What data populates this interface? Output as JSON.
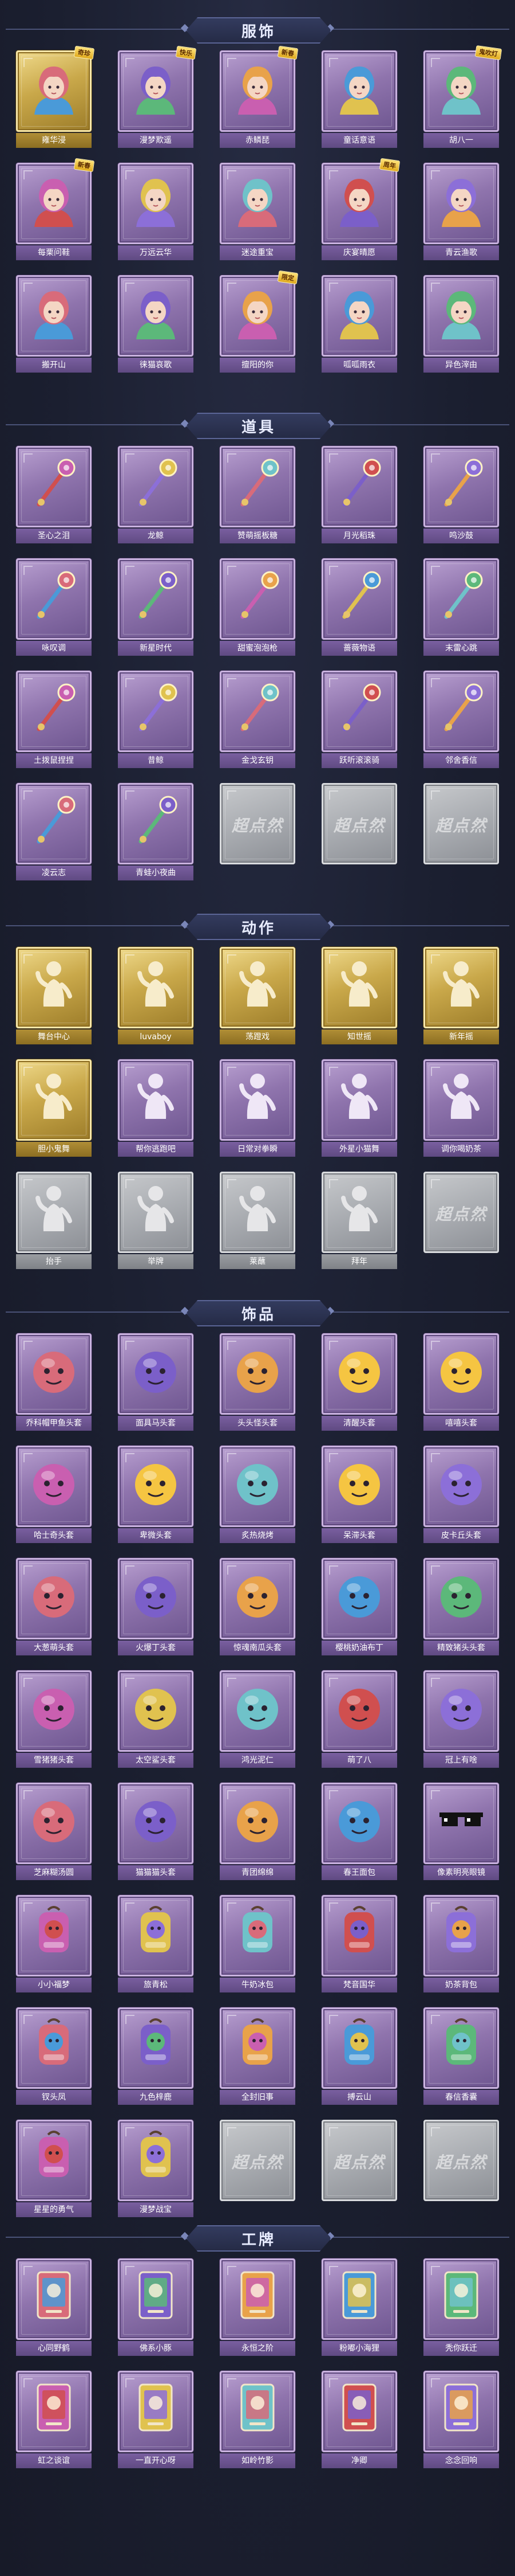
{
  "sections": [
    {
      "title": "服饰",
      "items": [
        {
          "label": "雍华浸",
          "style": "gold",
          "icon": "costume-portrait-icon",
          "ribbon": "奇珍"
        },
        {
          "label": "漫梦欺遥",
          "style": "purple",
          "icon": "costume-portrait-icon",
          "ribbon": "快乐"
        },
        {
          "label": "赤鳞琵",
          "style": "purple",
          "icon": "costume-portrait-icon",
          "ribbon": "新春"
        },
        {
          "label": "童话意语",
          "style": "purple",
          "icon": "costume-portrait-icon",
          "ribbon": ""
        },
        {
          "label": "胡八一",
          "style": "purple",
          "icon": "costume-portrait-icon",
          "ribbon": "鬼吹灯"
        },
        {
          "label": "每栗问鞋",
          "style": "purple",
          "icon": "costume-portrait-icon",
          "ribbon": "新春"
        },
        {
          "label": "万远云华",
          "style": "purple",
          "icon": "costume-portrait-icon",
          "ribbon": ""
        },
        {
          "label": "迷途重宝",
          "style": "purple",
          "icon": "costume-portrait-icon",
          "ribbon": ""
        },
        {
          "label": "庆宴晴愿",
          "style": "purple",
          "icon": "costume-portrait-icon",
          "ribbon": "周年"
        },
        {
          "label": "青云渔歌",
          "style": "purple",
          "icon": "costume-portrait-icon",
          "ribbon": ""
        },
        {
          "label": "搬开山",
          "style": "purple",
          "icon": "costume-portrait-icon",
          "ribbon": ""
        },
        {
          "label": "徕猫哀歌",
          "style": "purple",
          "icon": "costume-portrait-icon",
          "ribbon": ""
        },
        {
          "label": "擅阳的你",
          "style": "purple",
          "icon": "costume-portrait-icon",
          "ribbon": "限定"
        },
        {
          "label": "呱呱雨衣",
          "style": "purple",
          "icon": "costume-portrait-icon",
          "ribbon": ""
        },
        {
          "label": "异色滓由",
          "style": "purple",
          "icon": "costume-portrait-icon",
          "ribbon": ""
        }
      ]
    },
    {
      "title": "道具",
      "items": [
        {
          "label": "圣心之泪",
          "style": "purple",
          "icon": "scepter-icon"
        },
        {
          "label": "龙鲸",
          "style": "purple",
          "icon": "scepter-icon"
        },
        {
          "label": "赞萌摇板糖",
          "style": "purple",
          "icon": "wand-icon"
        },
        {
          "label": "月光稻珠",
          "style": "purple",
          "icon": "orb-icon"
        },
        {
          "label": "鸣沙鼓",
          "style": "purple",
          "icon": "ornament-icon"
        },
        {
          "label": "咏叹调",
          "style": "purple",
          "icon": "lantern-icon"
        },
        {
          "label": "新星时代",
          "style": "purple",
          "icon": "blaster-icon"
        },
        {
          "label": "甜蜜泡泡枪",
          "style": "purple",
          "icon": "blaster-icon"
        },
        {
          "label": "蔷薇物语",
          "style": "purple",
          "icon": "box-icon"
        },
        {
          "label": "末雷心跳",
          "style": "purple",
          "icon": "staff-icon"
        },
        {
          "label": "土拨鼠捏捏",
          "style": "purple",
          "icon": "plush-icon"
        },
        {
          "label": "昔鲸",
          "style": "purple",
          "icon": "spear-icon"
        },
        {
          "label": "金戈玄钥",
          "style": "purple",
          "icon": "lantern-icon"
        },
        {
          "label": "跃听滚滚骑",
          "style": "purple",
          "icon": "orb-icon"
        },
        {
          "label": "邻舍香信",
          "style": "purple",
          "icon": "ornament-icon"
        },
        {
          "label": "凌云志",
          "style": "purple",
          "icon": "sword-icon"
        },
        {
          "label": "青蛙小夜曲",
          "style": "purple",
          "icon": "frog-icon"
        },
        {
          "label": "",
          "style": "gray",
          "icon": "placeholder-icon"
        },
        {
          "label": "",
          "style": "gray",
          "icon": "placeholder-icon"
        },
        {
          "label": "",
          "style": "gray",
          "icon": "placeholder-icon"
        }
      ]
    },
    {
      "title": "动作",
      "items": [
        {
          "label": "舞台中心",
          "style": "gold",
          "icon": "gesture-icon"
        },
        {
          "label": "luvaboy",
          "style": "gold",
          "icon": "gesture-icon"
        },
        {
          "label": "荡蹬戏",
          "style": "gold",
          "icon": "gesture-icon"
        },
        {
          "label": "知世摇",
          "style": "gold",
          "icon": "gesture-icon"
        },
        {
          "label": "新年摇",
          "style": "gold",
          "icon": "gesture-icon"
        },
        {
          "label": "胆小鬼舞",
          "style": "gold",
          "icon": "gesture-icon"
        },
        {
          "label": "帮你逃跑吧",
          "style": "purple",
          "icon": "gesture-icon"
        },
        {
          "label": "日常对拳瞬",
          "style": "purple",
          "icon": "gesture-icon"
        },
        {
          "label": "外星小猫舞",
          "style": "purple",
          "icon": "gesture-icon"
        },
        {
          "label": "调你喝奶茶",
          "style": "purple",
          "icon": "gesture-icon"
        },
        {
          "label": "抬手",
          "style": "gray",
          "icon": "gesture-icon"
        },
        {
          "label": "举牌",
          "style": "gray",
          "icon": "gesture-icon"
        },
        {
          "label": "莱蘸",
          "style": "gray",
          "icon": "gesture-icon"
        },
        {
          "label": "拜年",
          "style": "gray",
          "icon": "gesture-icon"
        },
        {
          "label": "",
          "style": "gray",
          "icon": "placeholder-icon"
        }
      ]
    },
    {
      "title": "饰品",
      "items": [
        {
          "label": "乔科帽甲鱼头套",
          "style": "purple",
          "icon": "penguin-head-icon"
        },
        {
          "label": "面具马头套",
          "style": "purple",
          "icon": "horse-head-icon"
        },
        {
          "label": "头头怪头套",
          "style": "purple",
          "icon": "frog-head-icon"
        },
        {
          "label": "清醒头套",
          "style": "purple",
          "icon": "smiley-head-icon"
        },
        {
          "label": "嘻嘻头套",
          "style": "purple",
          "icon": "grin-head-icon"
        },
        {
          "label": "哈士奇头套",
          "style": "purple",
          "icon": "dog-head-icon"
        },
        {
          "label": "卑微头套",
          "style": "purple",
          "icon": "sad-head-icon"
        },
        {
          "label": "炙热烧烤",
          "style": "purple",
          "icon": "toast-head-icon"
        },
        {
          "label": "呆滞头套",
          "style": "purple",
          "icon": "shocked-head-icon"
        },
        {
          "label": "皮卡丘头套",
          "style": "purple",
          "icon": "pikachu-head-icon"
        },
        {
          "label": "大葱萌头套",
          "style": "purple",
          "icon": "sprout-head-icon"
        },
        {
          "label": "火爆丁头套",
          "style": "purple",
          "icon": "flame-head-icon"
        },
        {
          "label": "惊魂南瓜头套",
          "style": "purple",
          "icon": "pumpkin-head-icon"
        },
        {
          "label": "樱桃奶油布丁",
          "style": "purple",
          "icon": "pudding-head-icon"
        },
        {
          "label": "精致猪头头套",
          "style": "purple",
          "icon": "pig-head-icon"
        },
        {
          "label": "雪猪猪头套",
          "style": "purple",
          "icon": "snow-pig-head-icon"
        },
        {
          "label": "太空鲨头套",
          "style": "purple",
          "icon": "shark-head-icon"
        },
        {
          "label": "鸿光泥仁",
          "style": "purple",
          "icon": "doll-head-icon"
        },
        {
          "label": "萌了八",
          "style": "purple",
          "icon": "onion-head-icon"
        },
        {
          "label": "冠上有啥",
          "style": "purple",
          "icon": "bird-head-icon"
        },
        {
          "label": "芝麻糊汤圆",
          "style": "purple",
          "icon": "dumpling-head-icon"
        },
        {
          "label": "猫猫猫头套",
          "style": "purple",
          "icon": "cat-head-icon"
        },
        {
          "label": "青团绵绵",
          "style": "purple",
          "icon": "green-bun-head-icon"
        },
        {
          "label": "春王面包",
          "style": "purple",
          "icon": "bread-head-icon"
        },
        {
          "label": "像素明亮眼镜",
          "style": "purple",
          "icon": "pixel-glasses-icon"
        },
        {
          "label": "小小福梦",
          "style": "purple",
          "icon": "chick-pack-icon"
        },
        {
          "label": "旅青松",
          "style": "purple",
          "icon": "bonsai-pack-icon"
        },
        {
          "label": "牛奶冰包",
          "style": "purple",
          "icon": "milk-pack-icon"
        },
        {
          "label": "梵音国华",
          "style": "purple",
          "icon": "doll-pack-icon"
        },
        {
          "label": "奶茶背包",
          "style": "purple",
          "icon": "tea-pack-icon"
        },
        {
          "label": "钗头凤",
          "style": "purple",
          "icon": "doll-pack-icon"
        },
        {
          "label": "九色梓鹿",
          "style": "purple",
          "icon": "deer-pack-icon"
        },
        {
          "label": "全封旧事",
          "style": "purple",
          "icon": "figure-pack-icon"
        },
        {
          "label": "搏云山",
          "style": "purple",
          "icon": "charm-pack-icon"
        },
        {
          "label": "春信香囊",
          "style": "purple",
          "icon": "sachet-pack-icon"
        },
        {
          "label": "星星的勇气",
          "style": "purple",
          "icon": "star-pack-icon"
        },
        {
          "label": "漫梦战宝",
          "style": "purple",
          "icon": "robot-pack-icon"
        },
        {
          "label": "",
          "style": "gray",
          "icon": "placeholder-icon"
        },
        {
          "label": "",
          "style": "gray",
          "icon": "placeholder-icon"
        },
        {
          "label": "",
          "style": "gray",
          "icon": "placeholder-icon"
        }
      ]
    },
    {
      "title": "工牌",
      "items": [
        {
          "label": "心同野鹤",
          "style": "purple",
          "icon": "badge-icon"
        },
        {
          "label": "佛系小豚",
          "style": "purple",
          "icon": "badge-icon"
        },
        {
          "label": "永恒之阶",
          "style": "purple",
          "icon": "badge-icon"
        },
        {
          "label": "粉嘟小海狸",
          "style": "purple",
          "icon": "badge-icon"
        },
        {
          "label": "秃你跃迁",
          "style": "purple",
          "icon": "badge-icon"
        },
        {
          "label": "虹之谈谊",
          "style": "purple",
          "icon": "badge-icon"
        },
        {
          "label": "一直开心呀",
          "style": "purple",
          "icon": "badge-icon"
        },
        {
          "label": "如岭竹影",
          "style": "purple",
          "icon": "badge-icon"
        },
        {
          "label": "净卿",
          "style": "purple",
          "icon": "badge-icon"
        },
        {
          "label": "念念回响",
          "style": "purple",
          "icon": "badge-icon"
        }
      ]
    }
  ],
  "placeholder_watermark": "超点然",
  "colors": {
    "background": "#1b1f30",
    "card_purple": "#8f74ad",
    "card_gold": "#c9a84a",
    "card_gray": "#a9acb1",
    "header_plate": "#2c3352"
  }
}
